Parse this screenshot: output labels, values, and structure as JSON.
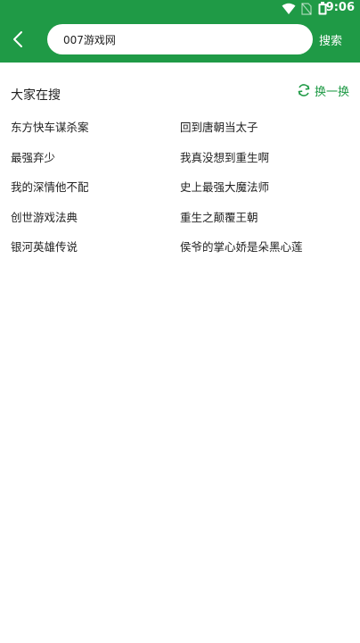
{
  "status_bar": {
    "time": "9:06"
  },
  "search": {
    "value": "007游戏网",
    "button_label": "搜索"
  },
  "hot": {
    "title": "大家在搜",
    "refresh_label": "换一换",
    "items": [
      "东方快车谋杀案",
      "回到唐朝当太子",
      "最强弃少",
      "我真没想到重生啊",
      "我的深情他不配",
      "史上最强大魔法师",
      "创世游戏法典",
      "重生之颠覆王朝",
      "银河英雄传说",
      "侯爷的掌心娇是朵黑心莲"
    ]
  },
  "colors": {
    "brand": "#1f9a46"
  }
}
